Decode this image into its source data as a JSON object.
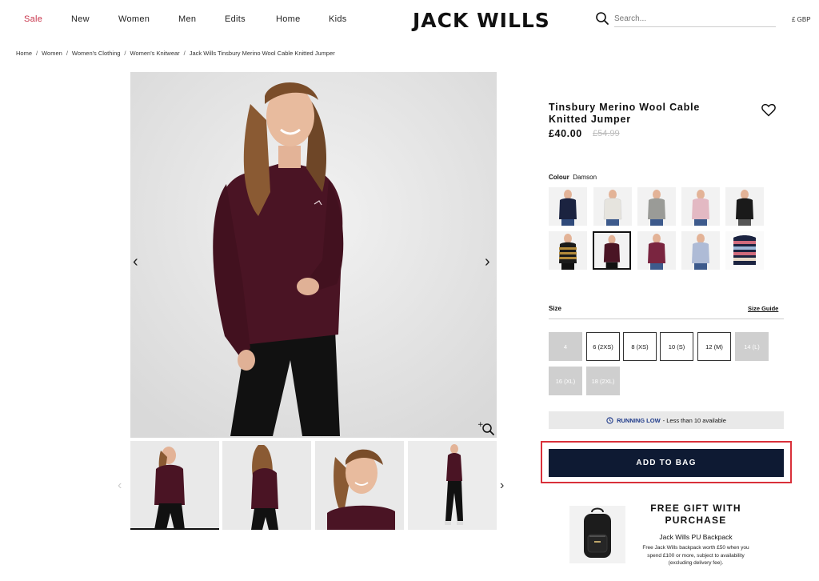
{
  "nav": {
    "items": [
      {
        "label": "Sale",
        "accent": "#c8334a"
      },
      {
        "label": "New"
      },
      {
        "label": "Women"
      },
      {
        "label": "Men"
      },
      {
        "label": "Edits"
      },
      {
        "label": "Home"
      },
      {
        "label": "Kids"
      }
    ]
  },
  "brand": {
    "logo": "JACK WILLS"
  },
  "search": {
    "placeholder": "Search...",
    "icon": "search-icon"
  },
  "currency": "£ GBP",
  "breadcrumb": [
    "Home",
    "Women",
    "Women's Clothing",
    "Women's Knitwear",
    "Jack Wills Tinsbury Merino Wool Cable Knitted Jumper"
  ],
  "product": {
    "title": "Tinsbury Merino Wool Cable Knitted Jumper",
    "price": "£40.00",
    "old_price": "£54.99",
    "colour_label": "Colour",
    "colour_value": "Damson",
    "swatches": [
      {
        "colour": "Navy",
        "hex": "#1b2340"
      },
      {
        "colour": "White",
        "hex": "#efeeea"
      },
      {
        "colour": "Grey",
        "hex": "#9a9b97"
      },
      {
        "colour": "Pink",
        "hex": "#e3b9c3"
      },
      {
        "colour": "Black",
        "hex": "#1a1a1a"
      },
      {
        "colour": "Stripe",
        "hex": "#b38a3a"
      },
      {
        "colour": "Damson",
        "hex": "#4a1424",
        "selected": true
      },
      {
        "colour": "Berry",
        "hex": "#7a2540"
      },
      {
        "colour": "Light Blue",
        "hex": "#aebbd6"
      },
      {
        "colour": "Multi Stripe",
        "hex": "#d06a7c"
      }
    ],
    "size_label": "Size",
    "size_guide": "Size Guide",
    "sizes": [
      {
        "label": "4",
        "available": false
      },
      {
        "label": "6 (2XS)",
        "available": true
      },
      {
        "label": "8 (XS)",
        "available": true
      },
      {
        "label": "10 (S)",
        "available": true
      },
      {
        "label": "12 (M)",
        "available": true
      },
      {
        "label": "14 (L)",
        "available": false
      },
      {
        "label": "16 (XL)",
        "available": false
      },
      {
        "label": "18 (2XL)",
        "available": false
      }
    ],
    "stock_status": "RUNNING LOW",
    "stock_detail": "- Less than 10 available",
    "add_to_bag": "ADD TO BAG",
    "accent": "#0e1a33",
    "highlight_color": "#d9303a"
  },
  "gift": {
    "title": "FREE GIFT WITH PURCHASE",
    "name": "Jack Wills PU Backpack",
    "description": "Free Jack Wills backpack worth £50 when you spend £100 or more, subject to availability (excluding delivery fee)."
  }
}
